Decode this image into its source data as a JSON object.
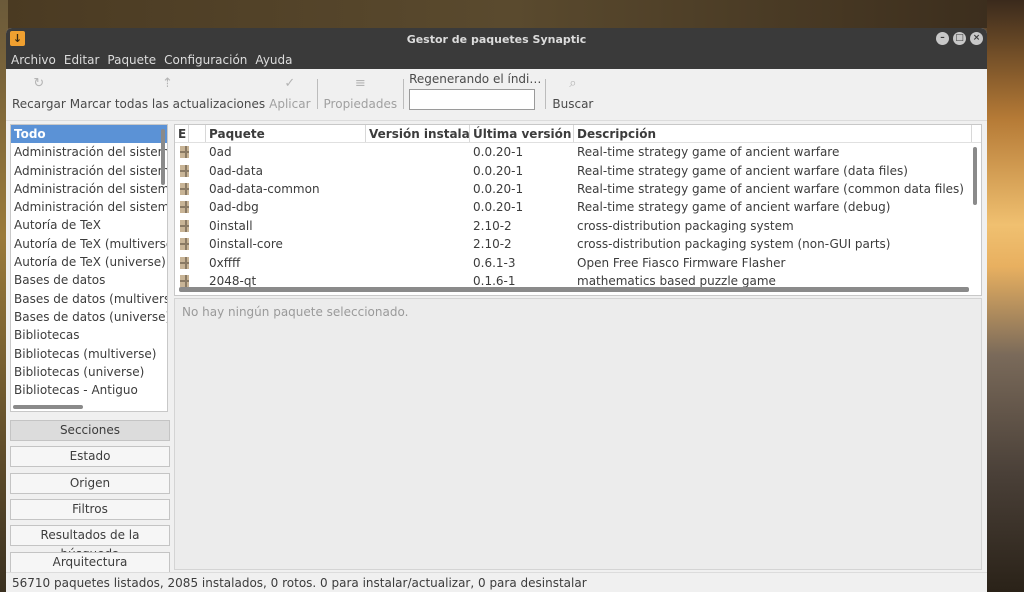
{
  "window": {
    "title": "Gestor de paquetes Synaptic"
  },
  "menu": [
    "Archivo",
    "Editar",
    "Paquete",
    "Configuración",
    "Ayuda"
  ],
  "toolbar": {
    "reload": "Recargar",
    "mark_all": "Marcar todas las actualizaciones",
    "apply": "Aplicar",
    "properties": "Propiedades",
    "search_label": "Regenerando el índi…",
    "search_value": "",
    "search": "Buscar"
  },
  "sections": [
    "Todo",
    "Administración del sistema",
    "Administración del sistema (multiverse)",
    "Administración del sistema (universe)",
    "Administración del sistema - Antiguo",
    "Autoría de TeX",
    "Autoría de TeX (multiverse)",
    "Autoría de TeX (universe)",
    "Bases de datos",
    "Bases de datos (multiverse)",
    "Bases de datos (universe)",
    "Bibliotecas",
    "Bibliotecas (multiverse)",
    "Bibliotecas (universe)",
    "Bibliotecas - Antiguo"
  ],
  "filters": [
    "Secciones",
    "Estado",
    "Origen",
    "Filtros",
    "Resultados de la búsqueda",
    "Arquitectura"
  ],
  "columns": {
    "e": "E",
    "package": "Paquete",
    "installed": "Versión instalada",
    "latest": "Última versión",
    "description": "Descripción"
  },
  "packages": [
    {
      "name": "0ad",
      "installed": "",
      "latest": "0.0.20-1",
      "description": "Real-time strategy game of ancient warfare"
    },
    {
      "name": "0ad-data",
      "installed": "",
      "latest": "0.0.20-1",
      "description": "Real-time strategy game of ancient warfare (data files)"
    },
    {
      "name": "0ad-data-common",
      "installed": "",
      "latest": "0.0.20-1",
      "description": "Real-time strategy game of ancient warfare (common data files)"
    },
    {
      "name": "0ad-dbg",
      "installed": "",
      "latest": "0.0.20-1",
      "description": "Real-time strategy game of ancient warfare (debug)"
    },
    {
      "name": "0install",
      "installed": "",
      "latest": "2.10-2",
      "description": "cross-distribution packaging system"
    },
    {
      "name": "0install-core",
      "installed": "",
      "latest": "2.10-2",
      "description": "cross-distribution packaging system (non-GUI parts)"
    },
    {
      "name": "0xffff",
      "installed": "",
      "latest": "0.6.1-3",
      "description": "Open Free Fiasco Firmware Flasher"
    },
    {
      "name": "2048-qt",
      "installed": "",
      "latest": "0.1.6-1",
      "description": "mathematics based puzzle game"
    }
  ],
  "details": {
    "empty": "No hay ningún paquete seleccionado."
  },
  "status": "56710 paquetes listados, 2085 instalados, 0 rotos. 0 para instalar/actualizar, 0 para desinstalar"
}
